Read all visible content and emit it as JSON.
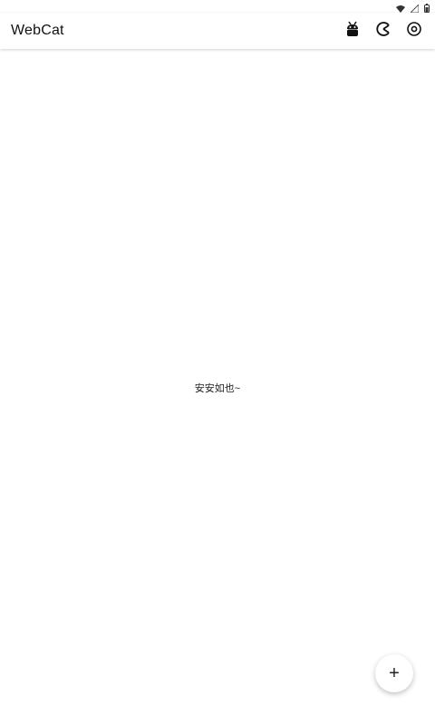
{
  "app_bar": {
    "title": "WebCat",
    "actions": [
      {
        "icon": "android-bug-icon"
      },
      {
        "icon": "pacman-icon"
      },
      {
        "icon": "eye-icon"
      }
    ]
  },
  "status_bar": {
    "icons": [
      "wifi-icon",
      "signal-icon",
      "battery-icon"
    ]
  },
  "main": {
    "empty_text": "安安如也~"
  },
  "fab": {
    "label": "+"
  }
}
